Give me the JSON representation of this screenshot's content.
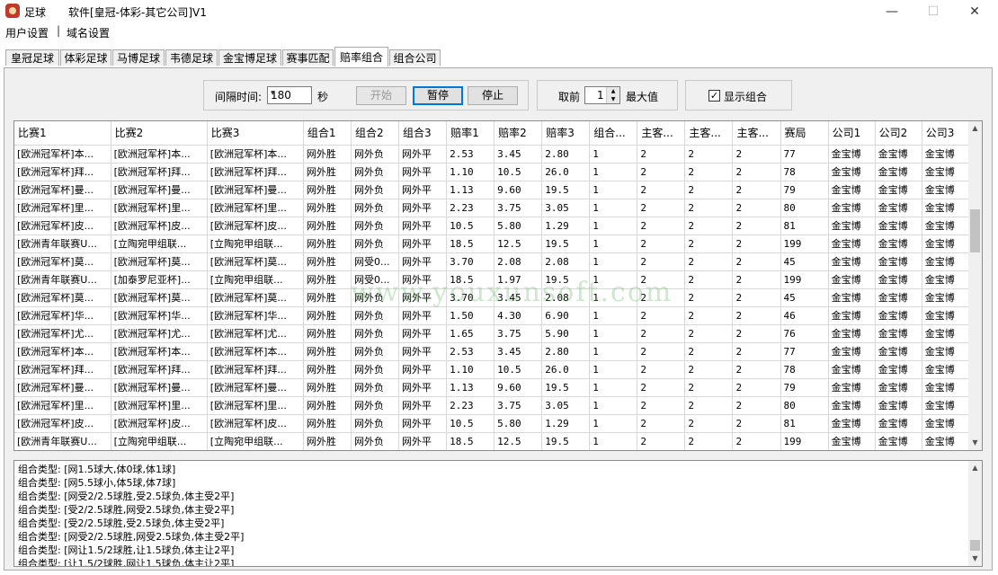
{
  "window": {
    "app_name": "足球",
    "title": "软件[皇冠-体彩-其它公司]V1",
    "minimize": "—",
    "maximize": "☐",
    "close": "✕"
  },
  "menu": [
    "用户设置",
    "域名设置"
  ],
  "menu_separator": "|",
  "tabs": [
    "皇冠足球",
    "体彩足球",
    "马博足球",
    "韦德足球",
    "金宝博足球",
    "赛事匹配",
    "赔率组合",
    "组合公司"
  ],
  "active_tab": "赔率组合",
  "toolbar": {
    "interval_label": "间隔时间:",
    "interval_value": "180",
    "seconds_label": "秒",
    "start_label": "开始",
    "pause_label": "暂停",
    "stop_label": "停止",
    "take_label": "取前",
    "take_value": "1",
    "max_label": "最大值",
    "show_combo_label": "显示组合",
    "show_combo_checked": true
  },
  "grid": {
    "columns": [
      "比赛1",
      "比赛2",
      "比赛3",
      "组合1",
      "组合2",
      "组合3",
      "赔率1",
      "赔率2",
      "赔率3",
      "组合...",
      "主客...",
      "主客...",
      "主客...",
      "赛局",
      "公司1",
      "公司2",
      "公司3"
    ],
    "rows": [
      [
        "[欧洲冠军杯]本...",
        "[欧洲冠军杯]本...",
        "[欧洲冠军杯]本...",
        "网外胜",
        "网外负",
        "网外平",
        "2.53",
        "3.45",
        "2.80",
        "1",
        "2",
        "2",
        "2",
        "77",
        "金宝博",
        "金宝博",
        "金宝博"
      ],
      [
        "[欧洲冠军杯]拜...",
        "[欧洲冠军杯]拜...",
        "[欧洲冠军杯]拜...",
        "网外胜",
        "网外负",
        "网外平",
        "1.10",
        "10.5",
        "26.0",
        "1",
        "2",
        "2",
        "2",
        "78",
        "金宝博",
        "金宝博",
        "金宝博"
      ],
      [
        "[欧洲冠军杯]曼...",
        "[欧洲冠军杯]曼...",
        "[欧洲冠军杯]曼...",
        "网外胜",
        "网外负",
        "网外平",
        "1.13",
        "9.60",
        "19.5",
        "1",
        "2",
        "2",
        "2",
        "79",
        "金宝博",
        "金宝博",
        "金宝博"
      ],
      [
        "[欧洲冠军杯]里...",
        "[欧洲冠军杯]里...",
        "[欧洲冠军杯]里...",
        "网外胜",
        "网外负",
        "网外平",
        "2.23",
        "3.75",
        "3.05",
        "1",
        "2",
        "2",
        "2",
        "80",
        "金宝博",
        "金宝博",
        "金宝博"
      ],
      [
        "[欧洲冠军杯]皮...",
        "[欧洲冠军杯]皮...",
        "[欧洲冠军杯]皮...",
        "网外胜",
        "网外负",
        "网外平",
        "10.5",
        "5.80",
        "1.29",
        "1",
        "2",
        "2",
        "2",
        "81",
        "金宝博",
        "金宝博",
        "金宝博"
      ],
      [
        "[欧洲青年联赛U...",
        "[立陶宛甲组联...",
        "[立陶宛甲组联...",
        "网外胜",
        "网外负",
        "网外平",
        "18.5",
        "12.5",
        "19.5",
        "1",
        "2",
        "2",
        "2",
        "199",
        "金宝博",
        "金宝博",
        "金宝博"
      ],
      [
        "[欧洲冠军杯]莫...",
        "[欧洲冠军杯]莫...",
        "[欧洲冠军杯]莫...",
        "网外胜",
        "网受0...",
        "网外平",
        "3.70",
        "2.08",
        "2.08",
        "1",
        "2",
        "2",
        "2",
        "45",
        "金宝博",
        "金宝博",
        "金宝博"
      ],
      [
        "[欧洲青年联赛U...",
        "[加泰罗尼亚杯]...",
        "[立陶宛甲组联...",
        "网外胜",
        "网受0...",
        "网外平",
        "18.5",
        "1.97",
        "19.5",
        "1",
        "2",
        "2",
        "2",
        "199",
        "金宝博",
        "金宝博",
        "金宝博"
      ],
      [
        "[欧洲冠军杯]莫...",
        "[欧洲冠军杯]莫...",
        "[欧洲冠军杯]莫...",
        "网外胜",
        "网外负",
        "网外平",
        "3.70",
        "3.45",
        "2.08",
        "1",
        "2",
        "2",
        "2",
        "45",
        "金宝博",
        "金宝博",
        "金宝博"
      ],
      [
        "[欧洲冠军杯]华...",
        "[欧洲冠军杯]华...",
        "[欧洲冠军杯]华...",
        "网外胜",
        "网外负",
        "网外平",
        "1.50",
        "4.30",
        "6.90",
        "1",
        "2",
        "2",
        "2",
        "46",
        "金宝博",
        "金宝博",
        "金宝博"
      ],
      [
        "[欧洲冠军杯]尤...",
        "[欧洲冠军杯]尤...",
        "[欧洲冠军杯]尤...",
        "网外胜",
        "网外负",
        "网外平",
        "1.65",
        "3.75",
        "5.90",
        "1",
        "2",
        "2",
        "2",
        "76",
        "金宝博",
        "金宝博",
        "金宝博"
      ],
      [
        "[欧洲冠军杯]本...",
        "[欧洲冠军杯]本...",
        "[欧洲冠军杯]本...",
        "网外胜",
        "网外负",
        "网外平",
        "2.53",
        "3.45",
        "2.80",
        "1",
        "2",
        "2",
        "2",
        "77",
        "金宝博",
        "金宝博",
        "金宝博"
      ],
      [
        "[欧洲冠军杯]拜...",
        "[欧洲冠军杯]拜...",
        "[欧洲冠军杯]拜...",
        "网外胜",
        "网外负",
        "网外平",
        "1.10",
        "10.5",
        "26.0",
        "1",
        "2",
        "2",
        "2",
        "78",
        "金宝博",
        "金宝博",
        "金宝博"
      ],
      [
        "[欧洲冠军杯]曼...",
        "[欧洲冠军杯]曼...",
        "[欧洲冠军杯]曼...",
        "网外胜",
        "网外负",
        "网外平",
        "1.13",
        "9.60",
        "19.5",
        "1",
        "2",
        "2",
        "2",
        "79",
        "金宝博",
        "金宝博",
        "金宝博"
      ],
      [
        "[欧洲冠军杯]里...",
        "[欧洲冠军杯]里...",
        "[欧洲冠军杯]里...",
        "网外胜",
        "网外负",
        "网外平",
        "2.23",
        "3.75",
        "3.05",
        "1",
        "2",
        "2",
        "2",
        "80",
        "金宝博",
        "金宝博",
        "金宝博"
      ],
      [
        "[欧洲冠军杯]皮...",
        "[欧洲冠军杯]皮...",
        "[欧洲冠军杯]皮...",
        "网外胜",
        "网外负",
        "网外平",
        "10.5",
        "5.80",
        "1.29",
        "1",
        "2",
        "2",
        "2",
        "81",
        "金宝博",
        "金宝博",
        "金宝博"
      ],
      [
        "[欧洲青年联赛U...",
        "[立陶宛甲组联...",
        "[立陶宛甲组联...",
        "网外胜",
        "网外负",
        "网外平",
        "18.5",
        "12.5",
        "19.5",
        "1",
        "2",
        "2",
        "2",
        "199",
        "金宝博",
        "金宝博",
        "金宝博"
      ]
    ]
  },
  "watermark": "www.youxunsoft.com",
  "log_lines": [
    "组合类型: [网1.5球大,体0球,体1球]",
    "组合类型: [网5.5球小,体5球,体7球]",
    "组合类型: [网受2/2.5球胜,受2.5球负,体主受2平]",
    "组合类型: [受2/2.5球胜,网受2.5球负,体主受2平]",
    "组合类型: [受2/2.5球胜,受2.5球负,体主受2平]",
    "组合类型: [网受2/2.5球胜,网受2.5球负,体主受2平]",
    "组合类型: [网让1.5/2球胜,让1.5球负,体主让2平]",
    "组合类型: [让1.5/2球胜,网让1.5球负,体主让2平]"
  ],
  "colors": {
    "accent": "#0078d7",
    "panel_bg": "#f0f0f0",
    "icon_red": "#c0392b"
  },
  "icons": {
    "app": "football-app-icon",
    "check": "✓",
    "dropdown": "▾",
    "scroll_up": "▲",
    "scroll_down": "▼"
  }
}
